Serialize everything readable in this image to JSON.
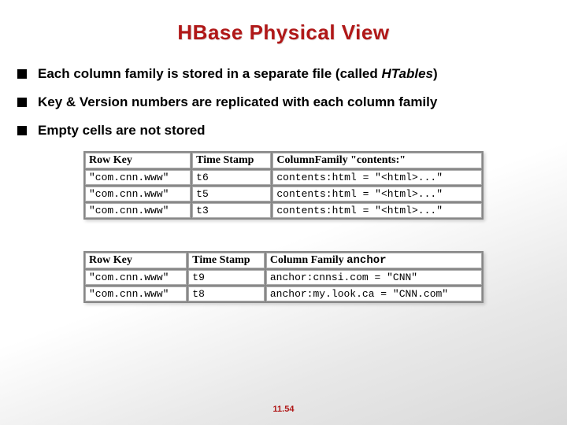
{
  "title": "HBase Physical View",
  "bullets": [
    {
      "pre": "Each column family is stored in a separate file (called ",
      "em": "HTables",
      "post": ")"
    },
    {
      "pre": "Key & Version numbers are replicated with each column family",
      "em": "",
      "post": ""
    },
    {
      "pre": "Empty cells are not stored",
      "em": "",
      "post": ""
    }
  ],
  "table1": {
    "headers": {
      "c0": "Row Key",
      "c1": "Time Stamp",
      "c2": "ColumnFamily \"contents:\""
    },
    "rows": [
      {
        "c0": "\"com.cnn.www\"",
        "c1": "t6",
        "c2": "contents:html = \"<html>...\""
      },
      {
        "c0": "\"com.cnn.www\"",
        "c1": "t5",
        "c2": "contents:html = \"<html>...\""
      },
      {
        "c0": "\"com.cnn.www\"",
        "c1": "t3",
        "c2": "contents:html = \"<html>...\""
      }
    ]
  },
  "table2": {
    "headers": {
      "c0": "Row Key",
      "c1": "Time Stamp",
      "c2_serif": "Column Family ",
      "c2_mono": "anchor"
    },
    "rows": [
      {
        "c0": "\"com.cnn.www\"",
        "c1": "t9",
        "c2": "anchor:cnnsi.com = \"CNN\""
      },
      {
        "c0": "\"com.cnn.www\"",
        "c1": "t8",
        "c2": "anchor:my.look.ca = \"CNN.com\""
      }
    ]
  },
  "footer": "11.54"
}
